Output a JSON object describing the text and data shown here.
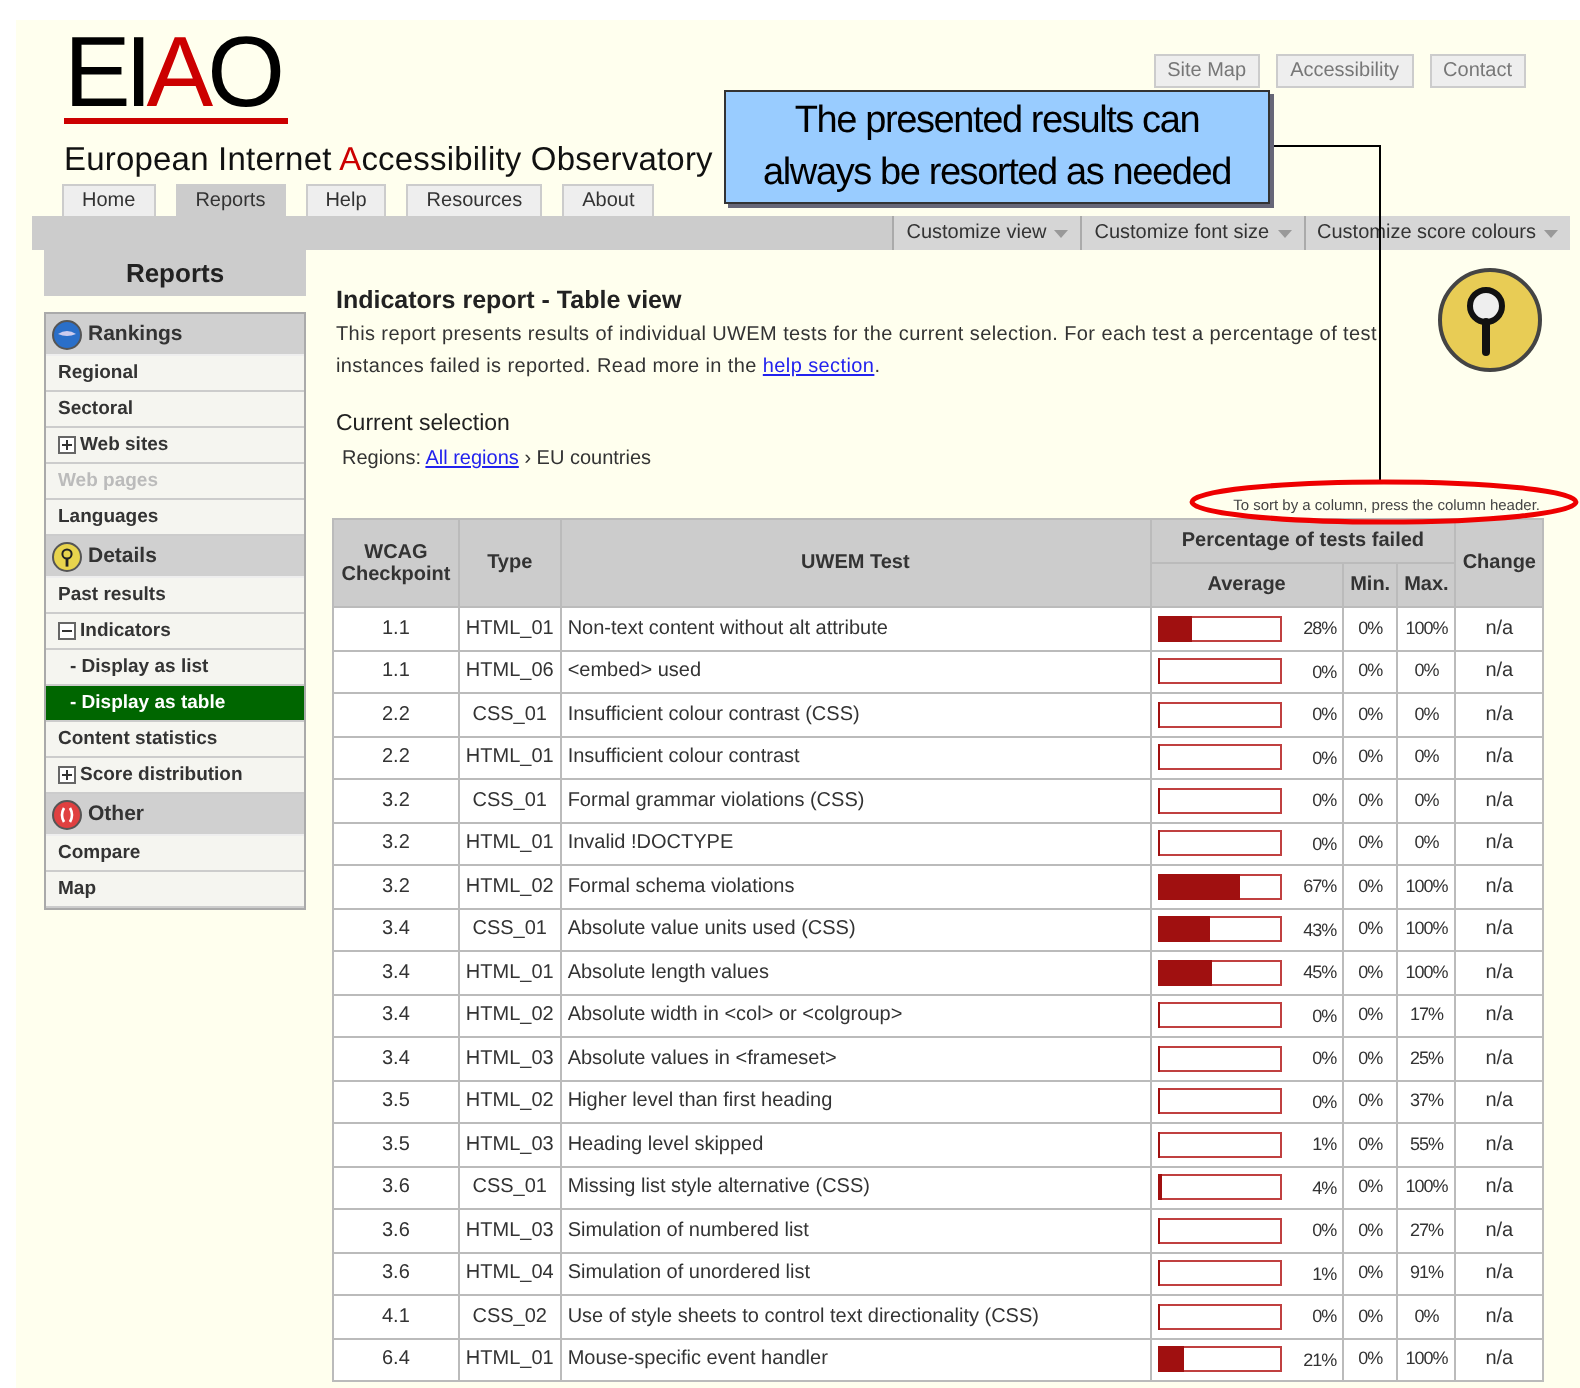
{
  "logo": {
    "parts": [
      {
        "text": "EI",
        "accent": false
      },
      {
        "text": "A",
        "accent": true
      },
      {
        "text": "O",
        "accent": false
      }
    ]
  },
  "site_title": {
    "parts": [
      {
        "text": "European Internet ",
        "accent": false
      },
      {
        "text": "A",
        "accent": true
      },
      {
        "text": "ccessibility Observatory",
        "accent": false
      }
    ]
  },
  "top_links": [
    "Site Map",
    "Accessibility",
    "Contact"
  ],
  "tabs": [
    {
      "label": "Home",
      "selected": false
    },
    {
      "label": "Reports",
      "selected": true
    },
    {
      "label": "Help",
      "selected": false
    },
    {
      "label": "Resources",
      "selected": false
    },
    {
      "label": "About",
      "selected": false
    }
  ],
  "toolbar_menus": [
    "Customize view",
    "Customize font size",
    "Customize score colours"
  ],
  "sidebar": {
    "title": "Reports",
    "groups": [
      {
        "title": "Rankings",
        "items": [
          {
            "label": "Regional",
            "kind": "link",
            "selected": false,
            "disabled": false
          },
          {
            "label": "Sectoral",
            "kind": "link",
            "selected": false,
            "disabled": false
          },
          {
            "label": "Web sites",
            "kind": "toggle",
            "expanded": false,
            "selected": false,
            "disabled": false
          },
          {
            "label": "Web pages",
            "kind": "link",
            "selected": false,
            "disabled": true
          },
          {
            "label": "Languages",
            "kind": "link",
            "selected": false,
            "disabled": false
          }
        ]
      },
      {
        "title": "Details",
        "items": [
          {
            "label": "Past results",
            "kind": "link",
            "selected": false,
            "disabled": false
          },
          {
            "label": "Indicators",
            "kind": "toggle",
            "expanded": true,
            "selected": false,
            "disabled": false,
            "children": [
              {
                "label": "- Display as list",
                "kind": "link",
                "selected": false,
                "disabled": false
              },
              {
                "label": "- Display as table",
                "kind": "link",
                "selected": true,
                "disabled": false
              }
            ]
          },
          {
            "label": "Content statistics",
            "kind": "link",
            "selected": false,
            "disabled": false
          },
          {
            "label": "Score distribution",
            "kind": "toggle",
            "expanded": false,
            "selected": false,
            "disabled": false
          }
        ]
      },
      {
        "title": "Other",
        "items": [
          {
            "label": "Compare",
            "kind": "link",
            "selected": false,
            "disabled": false
          },
          {
            "label": "Map",
            "kind": "link",
            "selected": false,
            "disabled": false
          }
        ]
      }
    ]
  },
  "content": {
    "title": "Indicators report - Table view",
    "description": {
      "before": "This report presents results of individual UWEM tests for the current selection. For each test a percentage of test instances failed is reported. Read more in the ",
      "link": "help section",
      "after": "."
    },
    "selection": {
      "heading": "Current selection",
      "label": "Regions:",
      "link": "All regions",
      "rest": "› EU countries"
    },
    "sort_hint": "To sort by a column, press the column header."
  },
  "table": {
    "headers": {
      "checkpoint": "WCAG Checkpoint",
      "type": "Type",
      "test": "UWEM Test",
      "percentage": "Percentage of tests failed",
      "average": "Average",
      "min": "Min.",
      "max": "Max.",
      "change": "Change"
    },
    "rows": [
      {
        "checkpoint": "1.1",
        "type": "HTML_01",
        "test": "Non-text content without alt attribute",
        "level": 0.28,
        "average": "28%",
        "min": "0%",
        "max": "100%",
        "change": "n/a"
      },
      {
        "checkpoint": "1.1",
        "type": "HTML_06",
        "test": "<embed> used",
        "level": 0,
        "average": "0%",
        "min": "0%",
        "max": "0%",
        "change": "n/a"
      },
      {
        "checkpoint": "2.2",
        "type": "CSS_01",
        "test": "Insufficient colour contrast (CSS)",
        "level": 0,
        "average": "0%",
        "min": "0%",
        "max": "0%",
        "change": "n/a"
      },
      {
        "checkpoint": "2.2",
        "type": "HTML_01",
        "test": "Insufficient colour contrast",
        "level": 0,
        "average": "0%",
        "min": "0%",
        "max": "0%",
        "change": "n/a"
      },
      {
        "checkpoint": "3.2",
        "type": "CSS_01",
        "test": "Formal grammar violations (CSS)",
        "level": 0,
        "average": "0%",
        "min": "0%",
        "max": "0%",
        "change": "n/a"
      },
      {
        "checkpoint": "3.2",
        "type": "HTML_01",
        "test": "Invalid !DOCTYPE",
        "level": 0,
        "average": "0%",
        "min": "0%",
        "max": "0%",
        "change": "n/a"
      },
      {
        "checkpoint": "3.2",
        "type": "HTML_02",
        "test": "Formal schema violations",
        "level": 0.67,
        "average": "67%",
        "min": "0%",
        "max": "100%",
        "change": "n/a"
      },
      {
        "checkpoint": "3.4",
        "type": "CSS_01",
        "test": "Absolute value units used (CSS)",
        "level": 0.43,
        "average": "43%",
        "min": "0%",
        "max": "100%",
        "change": "n/a"
      },
      {
        "checkpoint": "3.4",
        "type": "HTML_01",
        "test": "Absolute length values",
        "level": 0.45,
        "average": "45%",
        "min": "0%",
        "max": "100%",
        "change": "n/a"
      },
      {
        "checkpoint": "3.4",
        "type": "HTML_02",
        "test": "Absolute width in <col> or <colgroup>",
        "level": 0,
        "average": "0%",
        "min": "0%",
        "max": "17%",
        "change": "n/a"
      },
      {
        "checkpoint": "3.4",
        "type": "HTML_03",
        "test": "Absolute values in <frameset>",
        "level": 0,
        "average": "0%",
        "min": "0%",
        "max": "25%",
        "change": "n/a"
      },
      {
        "checkpoint": "3.5",
        "type": "HTML_02",
        "test": "Higher level than first heading",
        "level": 0,
        "average": "0%",
        "min": "0%",
        "max": "37%",
        "change": "n/a"
      },
      {
        "checkpoint": "3.5",
        "type": "HTML_03",
        "test": "Heading level skipped",
        "level": 0.01,
        "average": "1%",
        "min": "0%",
        "max": "55%",
        "change": "n/a"
      },
      {
        "checkpoint": "3.6",
        "type": "CSS_01",
        "test": "Missing list style alternative (CSS)",
        "level": 0.04,
        "average": "4%",
        "min": "0%",
        "max": "100%",
        "change": "n/a"
      },
      {
        "checkpoint": "3.6",
        "type": "HTML_03",
        "test": "Simulation of numbered list",
        "level": 0,
        "average": "0%",
        "min": "0%",
        "max": "27%",
        "change": "n/a"
      },
      {
        "checkpoint": "3.6",
        "type": "HTML_04",
        "test": "Simulation of unordered list",
        "level": 0.01,
        "average": "1%",
        "min": "0%",
        "max": "91%",
        "change": "n/a"
      },
      {
        "checkpoint": "4.1",
        "type": "CSS_02",
        "test": "Use of style sheets to control text directionality (CSS)",
        "level": 0,
        "average": "0%",
        "min": "0%",
        "max": "0%",
        "change": "n/a"
      },
      {
        "checkpoint": "6.4",
        "type": "HTML_01",
        "test": "Mouse-specific event handler",
        "level": 0.21,
        "average": "21%",
        "min": "0%",
        "max": "100%",
        "change": "n/a"
      }
    ]
  },
  "callout": {
    "text": "The presented results can always be resorted as needed"
  }
}
